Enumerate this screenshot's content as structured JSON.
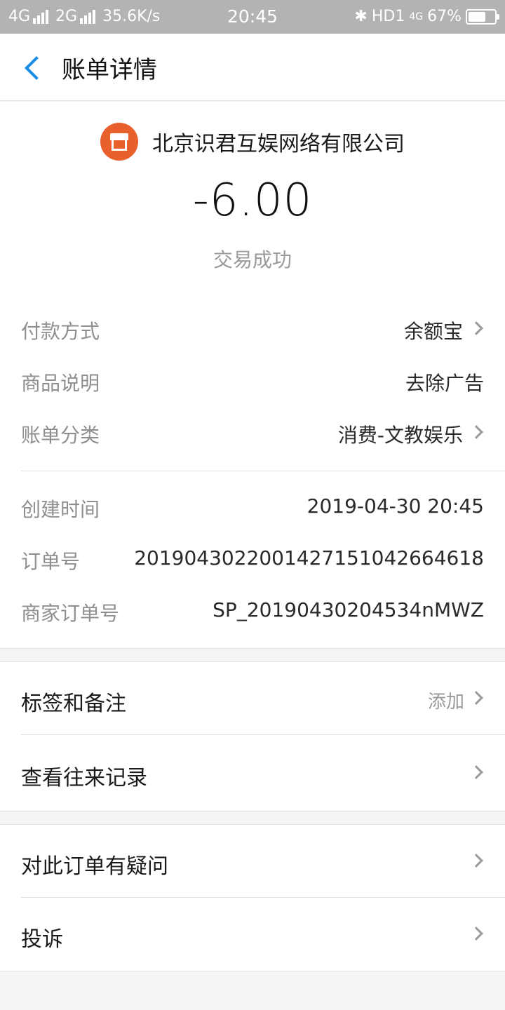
{
  "status_bar": {
    "left": "4G",
    "left2": "2G",
    "speed": "35.6K/s",
    "time": "20:45",
    "right_label": "HD1",
    "net": "4G",
    "battery": "67%",
    "battery_level": 0.67
  },
  "header": {
    "title": "账单详情"
  },
  "summary": {
    "merchant": "北京识君互娱网络有限公司",
    "amount": "-6.00",
    "status": "交易成功"
  },
  "details_group1": [
    {
      "label": "付款方式",
      "value": "余额宝"
    },
    {
      "label": "商品说明",
      "value": "去除广告"
    },
    {
      "label": "账单分类",
      "value": "消费-文教娱乐"
    }
  ],
  "details_group2": [
    {
      "label": "创建时间",
      "value": "2019-04-30 20:45"
    },
    {
      "label": "订单号",
      "value": "2019043022001427151042664618"
    },
    {
      "label": "商家订单号",
      "value": "SP_20190430204534nMWZ"
    }
  ],
  "menu1": [
    {
      "label": "标签和备注",
      "value": "添加"
    },
    {
      "label": "查看往来记录"
    }
  ],
  "menu2": [
    {
      "label": "对此订单有疑问"
    },
    {
      "label": "投诉"
    }
  ],
  "colors": {
    "accent": "#1a8ce3",
    "merchant_icon": "#e8602c"
  }
}
